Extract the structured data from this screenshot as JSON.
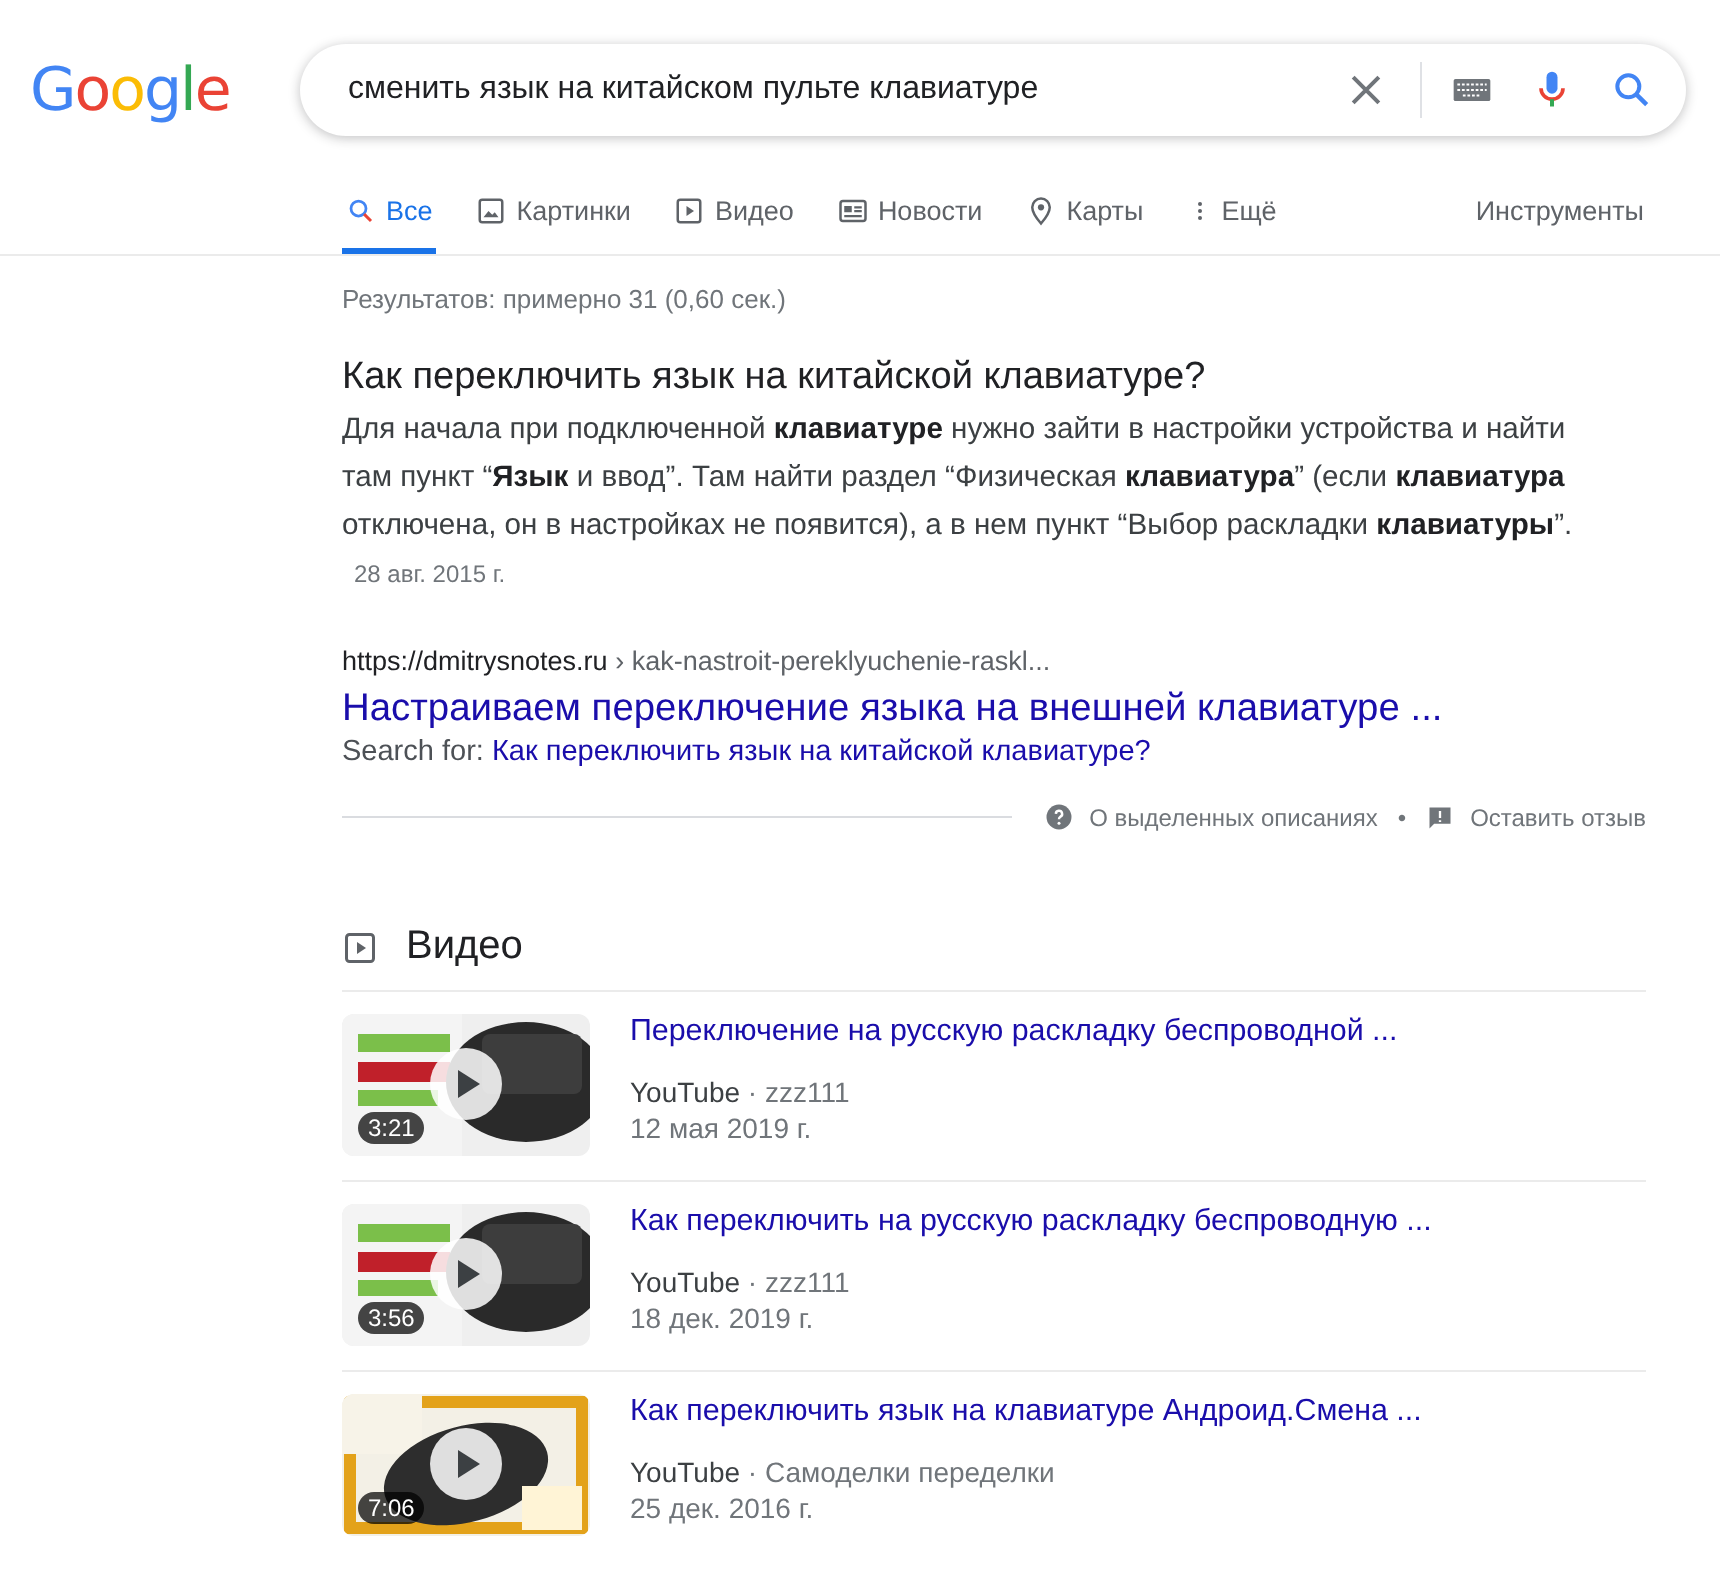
{
  "logo": "Google",
  "search": {
    "value": "сменить язык на китайском пульте клавиатуре"
  },
  "tabs": [
    {
      "label": "Все",
      "selected": true
    },
    {
      "label": "Картинки",
      "selected": false
    },
    {
      "label": "Видео",
      "selected": false
    },
    {
      "label": "Новости",
      "selected": false
    },
    {
      "label": "Карты",
      "selected": false
    },
    {
      "label": "Ещё",
      "selected": false
    }
  ],
  "tools": "Инструменты",
  "result_stats": "Результатов: примерно 31 (0,60 сек.)",
  "featured_snippet": {
    "question": "Как переключить язык на китайской клавиатуре?",
    "text": "Для начала при подключенной **клавиатуре** нужно зайти в настройки устройства и найти там пункт “**Язык** и ввод”. Там найти раздел “Физическая **клавиатура**” (если **клавиатура** отключена, он в настройках не появится), а в нем пункт “Выбор раскладки **клавиатуры**”.",
    "date": "28 авг. 2015 г.",
    "url": "https://dmitrysnotes.ru",
    "breadcrumb": "› kak-nastroit-pereklyuchenie-raskl...",
    "link_title": "Настраиваем переключение языка на внешней клавиатуре ...",
    "search_for_label": "Search for:",
    "search_for_link": "Как переключить язык на китайской клавиатуре?",
    "about": "О выделенных описаниях",
    "separator": "•",
    "feedback": "Оставить отзыв"
  },
  "videos": {
    "heading": "Видео",
    "items": [
      {
        "title": "Переключение на русскую раскладку беспроводной ...",
        "source": "YouTube",
        "channel": "· zzz111",
        "date": "12 мая 2019 г.",
        "duration": "3:21"
      },
      {
        "title": "Как переключить на русскую раскладку беспроводную ...",
        "source": "YouTube",
        "channel": "· zzz111",
        "date": "18 дек. 2019 г.",
        "duration": "3:56"
      },
      {
        "title": "Как переключить язык на клавиатуре Андроид.Смена ...",
        "source": "YouTube",
        "channel": "· Самоделки переделки",
        "date": "25 дек. 2016 г.",
        "duration": "7:06"
      }
    ]
  }
}
